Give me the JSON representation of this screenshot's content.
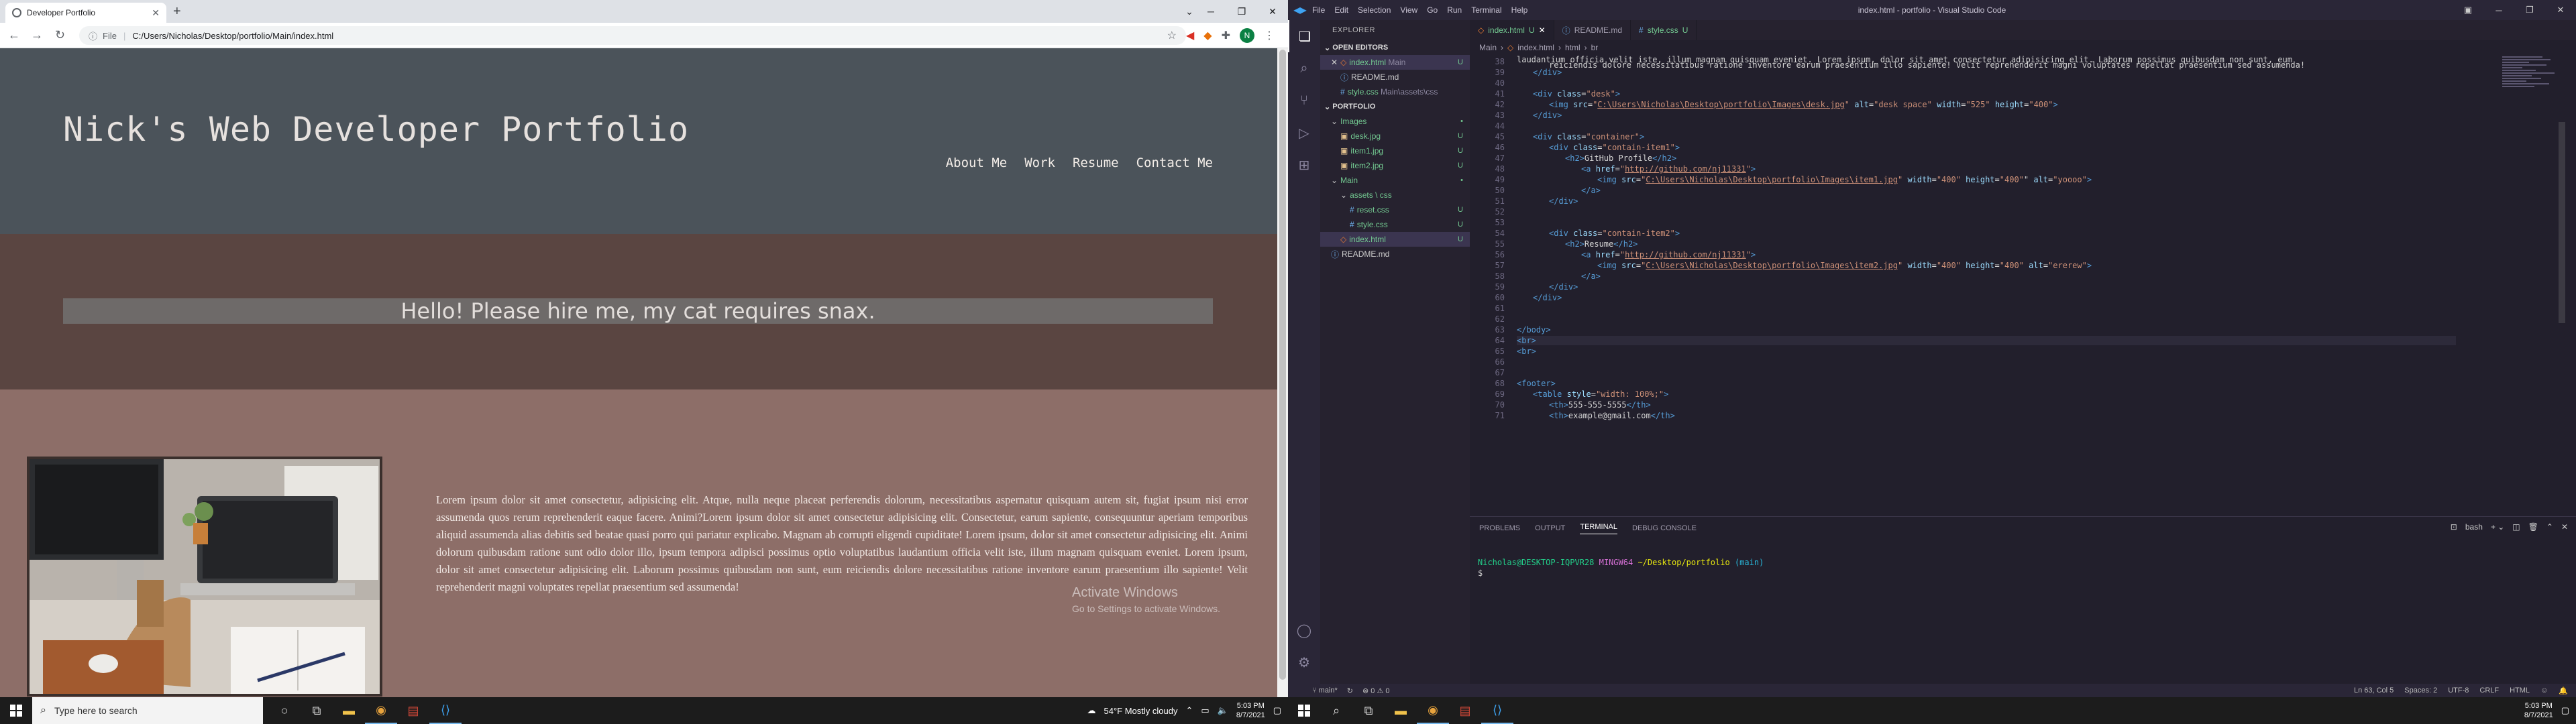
{
  "chrome": {
    "tab_title": "Developer Portfolio",
    "new_tab_label": "+",
    "address_label": "File",
    "address_value": "C:/Users/Nicholas/Desktop/portfolio/Main/index.html",
    "profile_initial": "N"
  },
  "site": {
    "title": "Nick's Web Developer Portfolio",
    "nav": [
      "About Me",
      "Work",
      "Resume",
      "Contact Me"
    ],
    "hero_text": "Hello! Please hire me, my cat requires snax.",
    "lorem": "Lorem ipsum dolor sit amet consectetur, adipisicing elit. Atque, nulla neque placeat perferendis dolorum, necessitatibus aspernatur quisquam autem sit, fugiat ipsum nisi error assumenda quos rerum reprehenderit eaque facere. Animi?Lorem ipsum dolor sit amet consectetur adipisicing elit. Consectetur, earum sapiente, consequuntur aperiam temporibus aliquid assumenda alias debitis sed beatae quasi porro qui pariatur explicabo. Magnam ab corrupti eligendi cupiditate! Lorem ipsum, dolor sit amet consectetur adipisicing elit. Animi dolorum quibusdam ratione sunt odio dolor illo, ipsum tempora adipisci possimus optio voluptatibus laudantium officia velit iste, illum magnam quisquam eveniet. Lorem ipsum, dolor sit amet consectetur adipisicing elit. Laborum possimus quibusdam non sunt, eum reiciendis dolore necessitatibus ratione inventore earum praesentium illo sapiente! Velit reprehenderit magni voluptates repellat praesentium sed assumenda!"
  },
  "activation": {
    "line1": "Activate Windows",
    "line2": "Go to Settings to activate Windows."
  },
  "taskbar_left": {
    "search_placeholder": "Type here to search",
    "weather": "54°F  Mostly cloudy",
    "time": "5:03 PM",
    "date": "8/7/2021"
  },
  "vscode": {
    "window_title": "index.html - portfolio - Visual Studio Code",
    "menu": [
      "File",
      "Edit",
      "Selection",
      "View",
      "Go",
      "Run",
      "Terminal",
      "Help"
    ],
    "explorer_title": "EXPLORER",
    "open_editors_title": "OPEN EDITORS",
    "open_editors": [
      {
        "name": "index.html",
        "hint": "Main",
        "status": "U"
      },
      {
        "name": "README.md",
        "hint": "",
        "status": ""
      },
      {
        "name": "style.css",
        "hint": "Main\\assets\\css",
        "status": ""
      }
    ],
    "portfolio_title": "PORTFOLIO",
    "tree": [
      {
        "name": "Images",
        "status": "•"
      },
      {
        "name": "desk.jpg",
        "status": "U"
      },
      {
        "name": "item1.jpg",
        "status": "U"
      },
      {
        "name": "item2.jpg",
        "status": "U"
      },
      {
        "name": "Main",
        "status": "•"
      },
      {
        "name": "assets \\ css",
        "status": ""
      },
      {
        "name": "reset.css",
        "status": "U"
      },
      {
        "name": "style.css",
        "status": "U"
      },
      {
        "name": "index.html",
        "status": "U"
      },
      {
        "name": "README.md",
        "status": ""
      }
    ],
    "tabs": [
      {
        "label": "index.html",
        "status": "U"
      },
      {
        "label": "README.md",
        "status": ""
      },
      {
        "label": "style.css",
        "status": "U"
      }
    ],
    "breadcrumbs": [
      "Main",
      "index.html",
      "html",
      "br"
    ],
    "line_numbers": [
      "38",
      "39",
      "40",
      "41",
      "42",
      "43",
      "44",
      "45",
      "46",
      "47",
      "48",
      "49",
      "50",
      "51",
      "52",
      "53",
      "54",
      "55",
      "56",
      "57",
      "58",
      "59",
      "60",
      "61",
      "62",
      "63",
      "64",
      "65",
      "66",
      "67",
      "68",
      "69",
      "70",
      "71"
    ],
    "code_top": "laudantium officia velit iste, illum magnam quisquam eveniet. Lorem ipsum, dolor sit amet consectetur adipisicing elit. Laborum possimus quibusdam non sunt, eum",
    "code_top2": "reiciendis dolore necessitatibus ratione inventore earum praesentium illo sapiente! Velit reprehenderit magni voluptates repellat praesentium sed assumenda!",
    "panel_tabs": [
      "PROBLEMS",
      "OUTPUT",
      "TERMINAL",
      "DEBUG CONSOLE"
    ],
    "terminal_shell": "bash",
    "terminal_user": "Nicholas@DESKTOP-IQPVR28",
    "terminal_sys": "MINGW64",
    "terminal_path": "~/Desktop/portfolio",
    "terminal_branch": "(main)",
    "terminal_prompt": "$",
    "status_branch": "main*",
    "status_problems": "⊗ 0  ⚠ 0",
    "status_pos": "Ln 63, Col 5",
    "status_spaces": "Spaces: 2",
    "status_enc": "UTF-8",
    "status_eol": "CRLF",
    "status_lang": "HTML",
    "time": "5:03 PM",
    "date": "8/7/2021"
  }
}
